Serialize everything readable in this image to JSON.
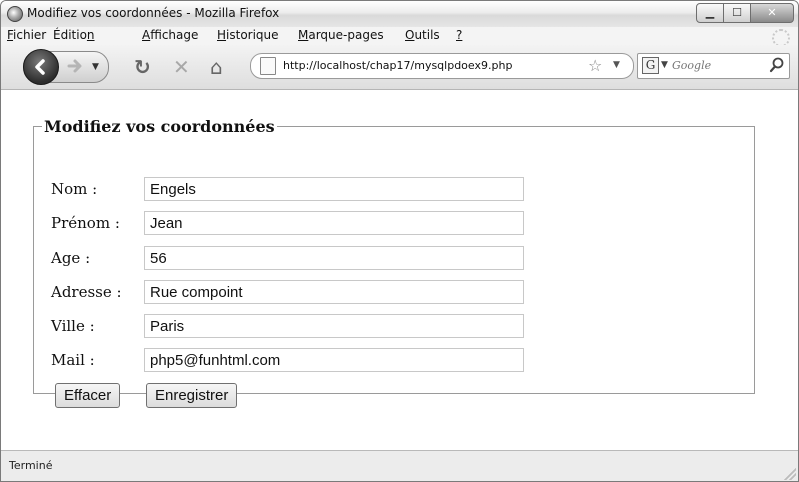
{
  "window": {
    "title": "Modifiez vos coordonnées - Mozilla Firefox"
  },
  "menubar": {
    "items": [
      {
        "label": "Fichier",
        "accel": "F",
        "rest": "ichier"
      },
      {
        "label": "Édition",
        "pre": "Éditio",
        "accel": "n",
        "rest": ""
      },
      {
        "label": "Affichage",
        "accel": "A",
        "rest": "ffichage"
      },
      {
        "label": "Historique",
        "accel": "H",
        "rest": "istorique"
      },
      {
        "label": "Marque-pages",
        "accel": "M",
        "rest": "arque-pages"
      },
      {
        "label": "Outils",
        "accel": "O",
        "rest": "utils"
      },
      {
        "label": "?",
        "accel": "?",
        "rest": ""
      }
    ]
  },
  "navbar": {
    "url": "http://localhost/chap17/mysqlpdoex9.php",
    "search_engine_letter": "G",
    "search_placeholder": "Google"
  },
  "form": {
    "legend": "Modifiez vos coordonnées",
    "fields": [
      {
        "label": "Nom :",
        "value": "Engels"
      },
      {
        "label": "Prénom :",
        "value": "Jean"
      },
      {
        "label": "Age :",
        "value": "56"
      },
      {
        "label": "Adresse :",
        "value": "Rue compoint"
      },
      {
        "label": "Ville :",
        "value": "Paris"
      },
      {
        "label": "Mail :",
        "value": "php5@funhtml.com"
      }
    ],
    "buttons": {
      "reset": "Effacer",
      "submit": "Enregistrer"
    }
  },
  "statusbar": {
    "text": "Terminé"
  },
  "colors": {
    "window_frame": "#7a7a7a",
    "content_bg": "#ffffff",
    "chrome_bg": "#e8e8e8"
  }
}
